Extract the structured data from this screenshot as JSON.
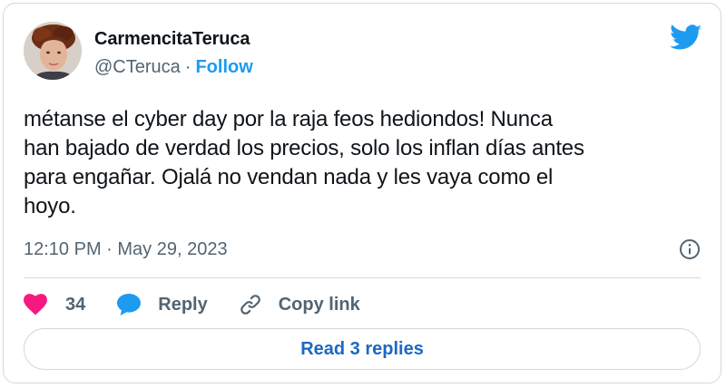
{
  "author": {
    "display_name": "CarmencitaTeruca",
    "handle": "@CTeruca",
    "separator": "·",
    "follow_label": "Follow"
  },
  "tweet": {
    "text": "métanse el cyber day por la raja feos hediondos! Nunca\nhan bajado de verdad los precios, solo los inflan días antes\npara engañar. Ojalá no vendan nada y les vaya como el\nhoyo.",
    "timestamp": "12:10 PM · May 29, 2023"
  },
  "actions": {
    "like_count": "34",
    "reply_label": "Reply",
    "copy_link_label": "Copy link"
  },
  "replies": {
    "read_label": "Read 3 replies"
  },
  "colors": {
    "brand_blue": "#1d9bf0",
    "link_blue": "#1d68c2",
    "like_pink": "#f91880",
    "secondary_text": "#536471",
    "border": "#cfd9de"
  },
  "icons": {
    "logo": "twitter-bird-icon",
    "info": "info-circle-icon",
    "like": "heart-icon",
    "reply": "speech-bubble-icon",
    "copy_link": "link-icon"
  }
}
